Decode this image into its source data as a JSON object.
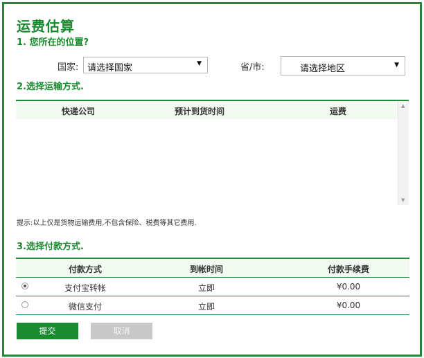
{
  "title": "运费估算",
  "location": {
    "heading": "1. 您所在的位置?",
    "country_label": "国家:",
    "country_value": "请选择国家",
    "province_label": "省/市:",
    "province_value": "请选择地区"
  },
  "shipping": {
    "heading": "2.选择运输方式.",
    "columns": [
      "快递公司",
      "预计到货时间",
      "运费"
    ],
    "tip": "提示:以上仅是货物运输费用,不包含保险、税费等其它费用."
  },
  "payment": {
    "heading": "3.选择付款方式.",
    "columns": [
      "付款方式",
      "到帐时间",
      "付款手续费"
    ],
    "rows": [
      {
        "method": "支付宝转帐",
        "time": "立即",
        "fee": "¥0.00",
        "selected": true
      },
      {
        "method": "微信支付",
        "time": "立即",
        "fee": "¥0.00",
        "selected": false
      }
    ]
  },
  "buttons": {
    "submit": "提交",
    "cancel": "取消"
  },
  "colors": {
    "accent": "#1a8a2e",
    "header_bg": "#f1f9f1"
  }
}
